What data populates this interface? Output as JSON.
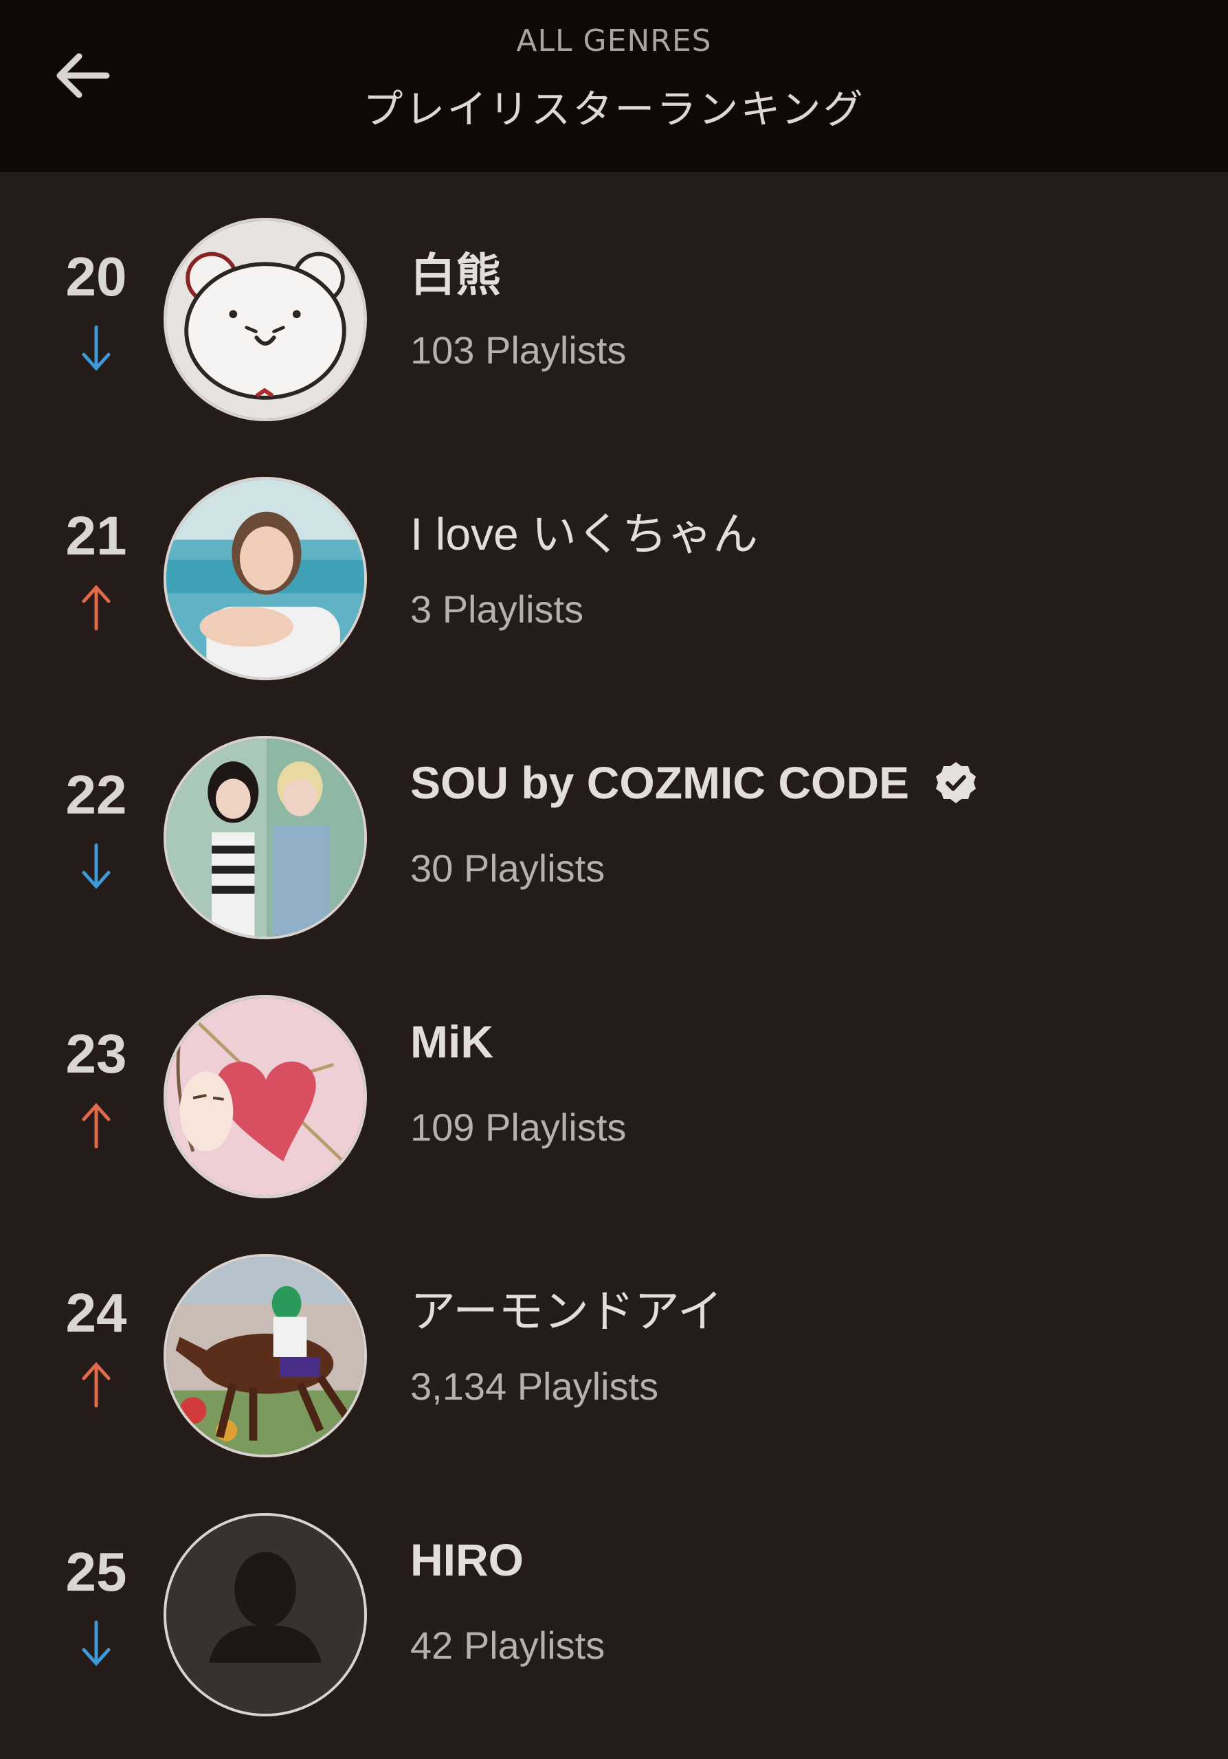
{
  "header": {
    "subtitle": "ALL GENRES",
    "title": "プレイリスターランキング"
  },
  "colors": {
    "background": "#251b18",
    "header_background": "#0f0807",
    "trend_down": "#3d9bd9",
    "trend_up": "#e06a4a"
  },
  "ranking": [
    {
      "rank": "20",
      "trend": "down",
      "name": "白熊",
      "playlists": "103 Playlists",
      "verified": false,
      "avatar_icon": "bear-avatar-icon"
    },
    {
      "rank": "21",
      "trend": "up",
      "name": "I love いくちゃん",
      "playlists": "3 Playlists",
      "verified": false,
      "avatar_icon": "photo-avatar-icon"
    },
    {
      "rank": "22",
      "trend": "down",
      "name": "SOU by COZMIC CODE",
      "playlists": "30 Playlists",
      "verified": true,
      "avatar_icon": "photo-avatar-icon"
    },
    {
      "rank": "23",
      "trend": "up",
      "name": "MiK",
      "playlists": "109 Playlists",
      "verified": false,
      "avatar_icon": "heart-illustration-avatar-icon"
    },
    {
      "rank": "24",
      "trend": "up",
      "name": "アーモンドアイ",
      "playlists": "3,134 Playlists",
      "verified": false,
      "avatar_icon": "horse-racing-avatar-icon"
    },
    {
      "rank": "25",
      "trend": "down",
      "name": "HIRO",
      "playlists": "42 Playlists",
      "verified": false,
      "avatar_icon": "default-user-avatar-icon"
    }
  ]
}
